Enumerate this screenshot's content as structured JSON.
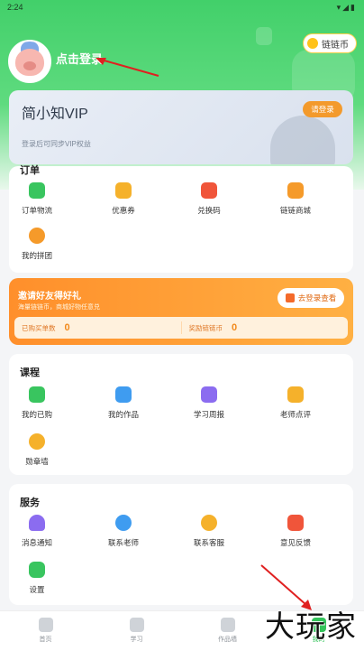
{
  "status_bar": {
    "time": "2:24",
    "icons": "▾◢▮"
  },
  "header": {
    "login_text": "点击登录",
    "coins_label": "链链币"
  },
  "vip": {
    "title": "简小知VIP",
    "subtitle": "登录后可同步VIP权益",
    "button": "请登录"
  },
  "orders": {
    "title": "订单",
    "items": [
      {
        "label": "订单物流",
        "icon": "order-logistics-icon",
        "color": "#39c55f"
      },
      {
        "label": "优惠券",
        "icon": "coupon-icon",
        "color": "#f5b12b"
      },
      {
        "label": "兑换码",
        "icon": "redeem-code-icon",
        "color": "#f0553a"
      },
      {
        "label": "链链商城",
        "icon": "mall-icon",
        "color": "#f59a2a"
      },
      {
        "label": "我的拼团",
        "icon": "group-buy-icon",
        "color": "#f59a2a"
      }
    ]
  },
  "invite": {
    "title": "邀请好友得好礼",
    "subtitle": "海量链链币，商城好物任意兑",
    "button": "去登录查看",
    "purchases_label": "已购买单数",
    "purchases_value": "0",
    "reward_label": "奖励链链币",
    "reward_value": "0"
  },
  "courses": {
    "title": "课程",
    "items": [
      {
        "label": "我的已购",
        "icon": "purchased-book-icon",
        "color": "#39c55f"
      },
      {
        "label": "我的作品",
        "icon": "artwork-icon",
        "color": "#3f9cf0"
      },
      {
        "label": "学习周报",
        "icon": "weekly-report-icon",
        "color": "#8b6cf0"
      },
      {
        "label": "老师点评",
        "icon": "teacher-review-icon",
        "color": "#f5b12b"
      },
      {
        "label": "勋章墙",
        "icon": "medal-icon",
        "color": "#f5b12b"
      }
    ]
  },
  "services": {
    "title": "服务",
    "items": [
      {
        "label": "消息通知",
        "icon": "bell-icon",
        "color": "#8b6cf0"
      },
      {
        "label": "联系老师",
        "icon": "teacher-icon",
        "color": "#3f9cf0"
      },
      {
        "label": "联系客服",
        "icon": "customer-service-icon",
        "color": "#f5b12b"
      },
      {
        "label": "意见反馈",
        "icon": "feedback-icon",
        "color": "#f0553a"
      },
      {
        "label": "设置",
        "icon": "settings-icon",
        "color": "#39c55f"
      }
    ]
  },
  "tabs": [
    {
      "label": "首页",
      "icon": "home-icon"
    },
    {
      "label": "学习",
      "icon": "study-icon"
    },
    {
      "label": "作品墙",
      "icon": "gallery-icon"
    },
    {
      "label": "我的",
      "icon": "profile-icon"
    }
  ],
  "watermark": "大玩家"
}
